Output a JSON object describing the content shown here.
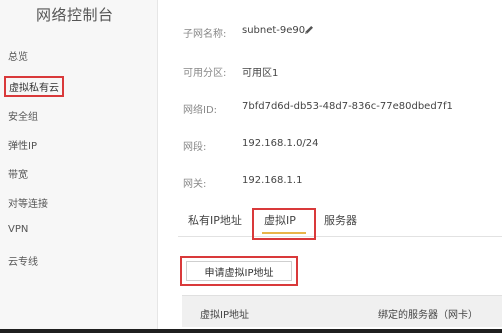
{
  "sidebar": {
    "title": "网络控制台",
    "items": [
      {
        "label": "总览"
      },
      {
        "label": "虚拟私有云"
      },
      {
        "label": "安全组"
      },
      {
        "label": "弹性IP"
      },
      {
        "label": "带宽"
      },
      {
        "label": "对等连接"
      },
      {
        "label": "VPN"
      },
      {
        "label": "云专线"
      }
    ]
  },
  "details": {
    "subnet_name": {
      "label": "子网名称:",
      "value": "subnet-9e90"
    },
    "zone": {
      "label": "可用分区:",
      "value": "可用区1"
    },
    "network_id": {
      "label": "网络ID:",
      "value": "7bfd7d6d-db53-48d7-836c-77e80dbed7f1"
    },
    "cidr": {
      "label": "网段:",
      "value": "192.168.1.0/24"
    },
    "gateway": {
      "label": "网关:",
      "value": "192.168.1.1"
    }
  },
  "tabs": [
    {
      "label": "私有IP地址"
    },
    {
      "label": "虚拟IP"
    },
    {
      "label": "服务器"
    }
  ],
  "apply_button": {
    "label": "申请虚拟IP地址"
  },
  "table": {
    "headers": [
      "虚拟IP地址",
      "绑定的服务器（网卡）"
    ]
  },
  "icons": {
    "edit": "pencil-icon"
  },
  "colors": {
    "highlight": "#d9393a",
    "tab_underline": "#e8b54a"
  }
}
